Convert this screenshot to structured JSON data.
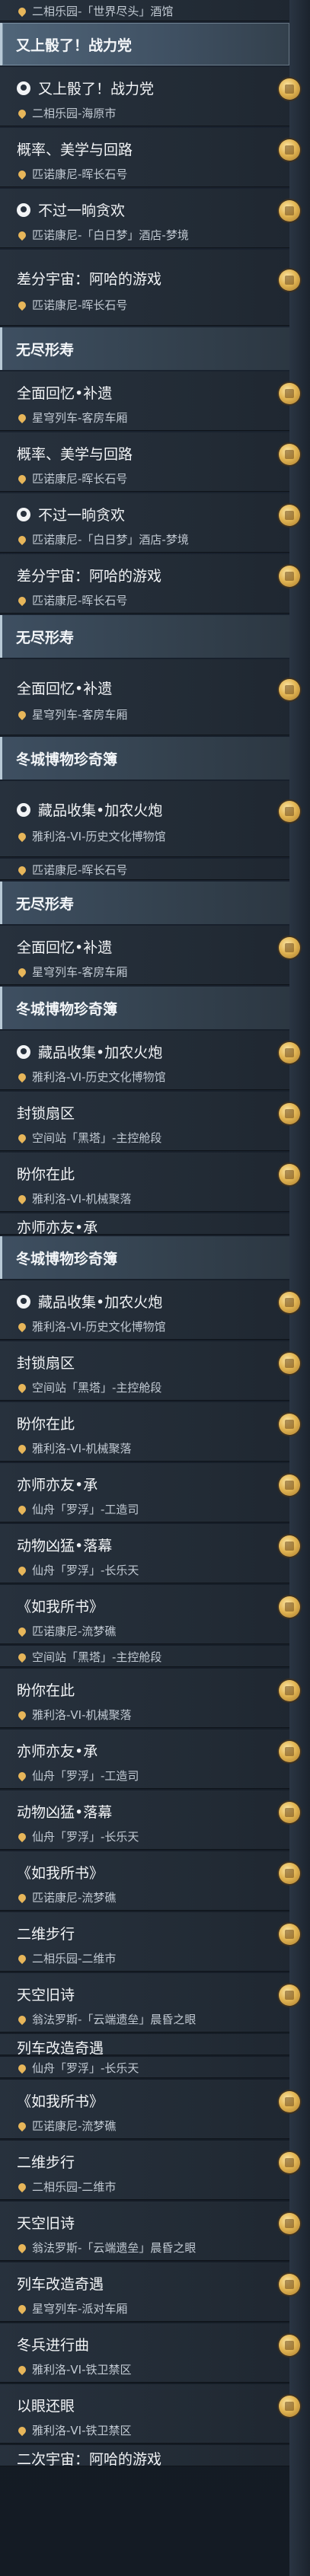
{
  "colors": {
    "header_bg": "#3e4f61",
    "quest_bg": "#27313d",
    "accent_pin": "#e7b65a",
    "reward": "#e2b553"
  },
  "rows": [
    {
      "kind": "quest",
      "title": "",
      "loc": "二相乐园-「世界尽头」酒馆",
      "partial": true,
      "icon": false
    },
    {
      "kind": "header",
      "title": "又上骰了！战力党",
      "sel": true
    },
    {
      "kind": "quest",
      "title": "又上骰了！战力党",
      "loc": "二相乐园-海原市",
      "icon": true
    },
    {
      "kind": "quest",
      "title": "概率、美学与回路",
      "loc": "匹诺康尼-晖长石号",
      "icon": false
    },
    {
      "kind": "quest",
      "title": "不过一晌贪欢",
      "loc": "匹诺康尼-「白日梦」酒店-梦境",
      "icon": true
    },
    {
      "kind": "quest",
      "title": "差分宇宙：阿哈的游戏",
      "loc": "匹诺康尼-晖长石号",
      "icon": false,
      "tall": true
    },
    {
      "kind": "header",
      "title": "无尽形寿"
    },
    {
      "kind": "quest",
      "title": "全面回忆•补遗",
      "loc": "星穹列车-客房车厢",
      "icon": false
    },
    {
      "kind": "quest",
      "title": "概率、美学与回路",
      "loc": "匹诺康尼-晖长石号",
      "icon": false
    },
    {
      "kind": "quest",
      "title": "不过一晌贪欢",
      "loc": "匹诺康尼-「白日梦」酒店-梦境",
      "icon": true
    },
    {
      "kind": "quest",
      "title": "差分宇宙：阿哈的游戏",
      "loc": "匹诺康尼-晖长石号",
      "icon": false
    },
    {
      "kind": "header",
      "title": "无尽形寿"
    },
    {
      "kind": "quest",
      "title": "全面回忆•补遗",
      "loc": "星穹列车-客房车厢",
      "icon": false,
      "tall": true
    },
    {
      "kind": "header",
      "title": "冬城博物珍奇簿"
    },
    {
      "kind": "quest",
      "title": "藏品收集•加农火炮",
      "loc": "雅利洛-VI-历史文化博物馆",
      "icon": true,
      "tall": true
    },
    {
      "kind": "quest",
      "title": "",
      "loc": "匹诺康尼-晖长石号",
      "partial": true,
      "icon": false
    },
    {
      "kind": "header",
      "title": "无尽形寿"
    },
    {
      "kind": "quest",
      "title": "全面回忆•补遗",
      "loc": "星穹列车-客房车厢",
      "icon": false
    },
    {
      "kind": "header",
      "title": "冬城博物珍奇簿"
    },
    {
      "kind": "quest",
      "title": "藏品收集•加农火炮",
      "loc": "雅利洛-VI-历史文化博物馆",
      "icon": true
    },
    {
      "kind": "quest",
      "title": "封锁扇区",
      "loc": "空间站「黑塔」-主控舱段",
      "icon": false
    },
    {
      "kind": "quest",
      "title": "盼你在此",
      "loc": "雅利洛-VI-机械聚落",
      "icon": false
    },
    {
      "kind": "quest",
      "title": "亦师亦友•承",
      "loc": "",
      "icon": false,
      "partial": true
    },
    {
      "kind": "header",
      "title": "冬城博物珍奇簿"
    },
    {
      "kind": "quest",
      "title": "藏品收集•加农火炮",
      "loc": "雅利洛-VI-历史文化博物馆",
      "icon": true
    },
    {
      "kind": "quest",
      "title": "封锁扇区",
      "loc": "空间站「黑塔」-主控舱段",
      "icon": false
    },
    {
      "kind": "quest",
      "title": "盼你在此",
      "loc": "雅利洛-VI-机械聚落",
      "icon": false
    },
    {
      "kind": "quest",
      "title": "亦师亦友•承",
      "loc": "仙舟「罗浮」-工造司",
      "icon": false
    },
    {
      "kind": "quest",
      "title": "动物凶猛•落幕",
      "loc": "仙舟「罗浮」-长乐天",
      "icon": false
    },
    {
      "kind": "quest",
      "title": "《如我所书》",
      "loc": "匹诺康尼-流梦礁",
      "icon": false
    },
    {
      "kind": "quest",
      "title": "",
      "loc": "空间站「黑塔」-主控舱段",
      "partial": true,
      "icon": false
    },
    {
      "kind": "quest",
      "title": "盼你在此",
      "loc": "雅利洛-VI-机械聚落",
      "icon": false
    },
    {
      "kind": "quest",
      "title": "亦师亦友•承",
      "loc": "仙舟「罗浮」-工造司",
      "icon": false
    },
    {
      "kind": "quest",
      "title": "动物凶猛•落幕",
      "loc": "仙舟「罗浮」-长乐天",
      "icon": false
    },
    {
      "kind": "quest",
      "title": "《如我所书》",
      "loc": "匹诺康尼-流梦礁",
      "icon": false
    },
    {
      "kind": "quest",
      "title": "二维步行",
      "loc": "二相乐园-二维市",
      "icon": false
    },
    {
      "kind": "quest",
      "title": "天空旧诗",
      "loc": "翁法罗斯-「云端遗垒」晨昏之眼",
      "icon": false
    },
    {
      "kind": "quest",
      "title": "列车改造奇遇",
      "loc": "",
      "icon": false,
      "partial": true
    },
    {
      "kind": "quest",
      "title": "",
      "loc": "仙舟「罗浮」-长乐天",
      "partial": true,
      "icon": false
    },
    {
      "kind": "quest",
      "title": "《如我所书》",
      "loc": "匹诺康尼-流梦礁",
      "icon": false
    },
    {
      "kind": "quest",
      "title": "二维步行",
      "loc": "二相乐园-二维市",
      "icon": false
    },
    {
      "kind": "quest",
      "title": "天空旧诗",
      "loc": "翁法罗斯-「云端遗垒」晨昏之眼",
      "icon": false
    },
    {
      "kind": "quest",
      "title": "列车改造奇遇",
      "loc": "星穹列车-派对车厢",
      "icon": false
    },
    {
      "kind": "quest",
      "title": "冬兵进行曲",
      "loc": "雅利洛-VI-铁卫禁区",
      "icon": false
    },
    {
      "kind": "quest",
      "title": "以眼还眼",
      "loc": "雅利洛-VI-铁卫禁区",
      "icon": false
    },
    {
      "kind": "quest",
      "title": "二次宇宙：阿哈的游戏",
      "loc": "",
      "partial": true,
      "icon": false
    }
  ]
}
